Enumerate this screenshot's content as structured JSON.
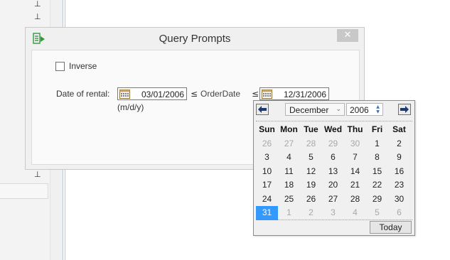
{
  "dialog": {
    "title": "Query Prompts",
    "close_glyph": "✕",
    "inverse_label": "Inverse",
    "date_label": "Date of rental:",
    "start_date": "03/01/2006",
    "le_symbol_1": "≤",
    "field_name": "OrderDate",
    "le_symbol_2": "≤",
    "end_date": "12/31/2006",
    "format_hint": "(m/d/y)"
  },
  "calendar": {
    "month": "December",
    "year": "2006",
    "day_headers": [
      "Sun",
      "Mon",
      "Tue",
      "Wed",
      "Thu",
      "Fri",
      "Sat"
    ],
    "weeks": [
      [
        "26",
        "27",
        "28",
        "29",
        "30",
        "1",
        "2"
      ],
      [
        "3",
        "4",
        "5",
        "6",
        "7",
        "8",
        "9"
      ],
      [
        "10",
        "11",
        "12",
        "13",
        "14",
        "15",
        "16"
      ],
      [
        "17",
        "18",
        "19",
        "20",
        "21",
        "22",
        "23"
      ],
      [
        "24",
        "25",
        "26",
        "27",
        "28",
        "29",
        "30"
      ],
      [
        "31",
        "1",
        "2",
        "3",
        "4",
        "5",
        "6"
      ]
    ],
    "selected_day": "31",
    "today_label": "Today"
  },
  "icons": {
    "app": "query-builder-icon",
    "calendar": "calendar-icon",
    "prev": "arrow-left-icon",
    "next": "arrow-right-icon",
    "pin": "pin-icon"
  },
  "colors": {
    "selection": "#3399ff",
    "close_button": "#c8c8c8",
    "dialog_bg": "#f0f0f0",
    "app_icon": "#2e9a3d"
  }
}
